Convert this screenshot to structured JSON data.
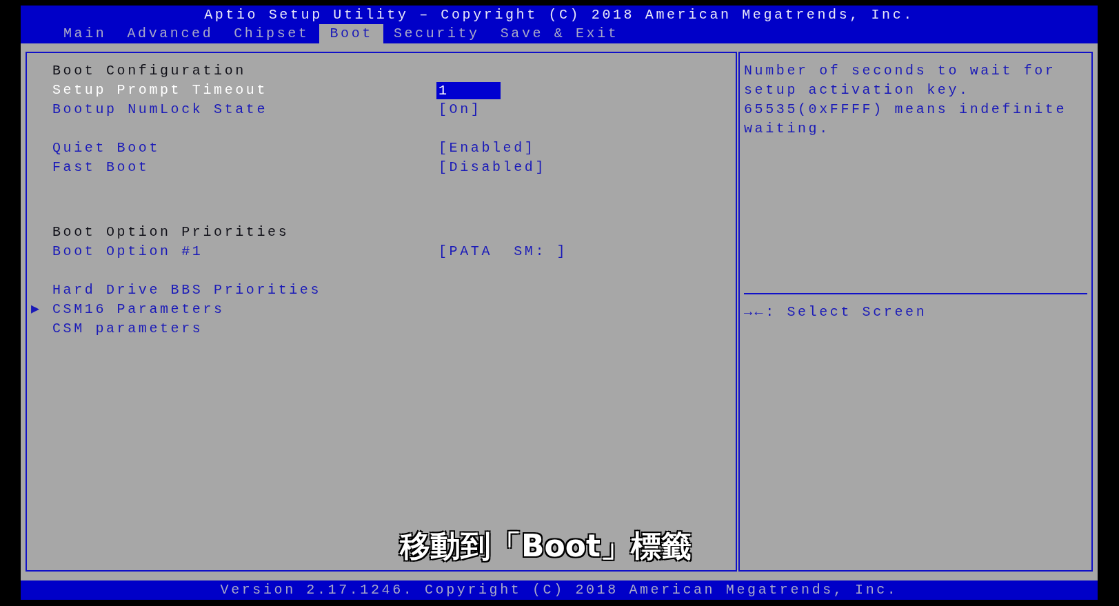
{
  "header": {
    "title": "Aptio Setup Utility – Copyright (C) 2018 American Megatrends, Inc."
  },
  "tabs": [
    {
      "label": "Main",
      "selected": false
    },
    {
      "label": "Advanced",
      "selected": false
    },
    {
      "label": "Chipset",
      "selected": false
    },
    {
      "label": "Boot",
      "selected": true
    },
    {
      "label": "Security",
      "selected": false
    },
    {
      "label": "Save & Exit",
      "selected": false
    }
  ],
  "sections": [
    {
      "items": [
        {
          "kind": "heading",
          "label": "Boot Configuration"
        },
        {
          "kind": "setting",
          "label": "Setup Prompt Timeout",
          "value": "1",
          "selected": true
        },
        {
          "kind": "setting",
          "label": "Bootup NumLock State",
          "value": "[On]",
          "selected": false
        }
      ]
    },
    {
      "items": [
        {
          "kind": "setting",
          "label": "Quiet Boot",
          "value": "[Enabled]",
          "selected": false
        },
        {
          "kind": "setting",
          "label": "Fast Boot",
          "value": "[Disabled]",
          "selected": false
        }
      ]
    },
    {
      "items": [
        {
          "kind": "heading",
          "label": "Boot Option Priorities"
        },
        {
          "kind": "setting",
          "label": "Boot Option #1",
          "value": "[PATA  SM: ]",
          "selected": false
        }
      ]
    },
    {
      "items": [
        {
          "kind": "link",
          "label": "Hard Drive BBS Priorities",
          "selected": false
        },
        {
          "kind": "link",
          "label": "CSM16 Parameters",
          "marker": "▶",
          "selected": false
        },
        {
          "kind": "link",
          "label": "CSM parameters",
          "selected": false
        }
      ]
    }
  ],
  "help": {
    "text": "Number of seconds to wait for setup activation key. 65535(0xFFFF) means indefinite waiting.",
    "keys": [
      "→←: Select Screen"
    ]
  },
  "subtitle": "移動到「Boot」標籤",
  "footer": "Version 2.17.1246. Copyright (C) 2018 American Megatrends, Inc."
}
